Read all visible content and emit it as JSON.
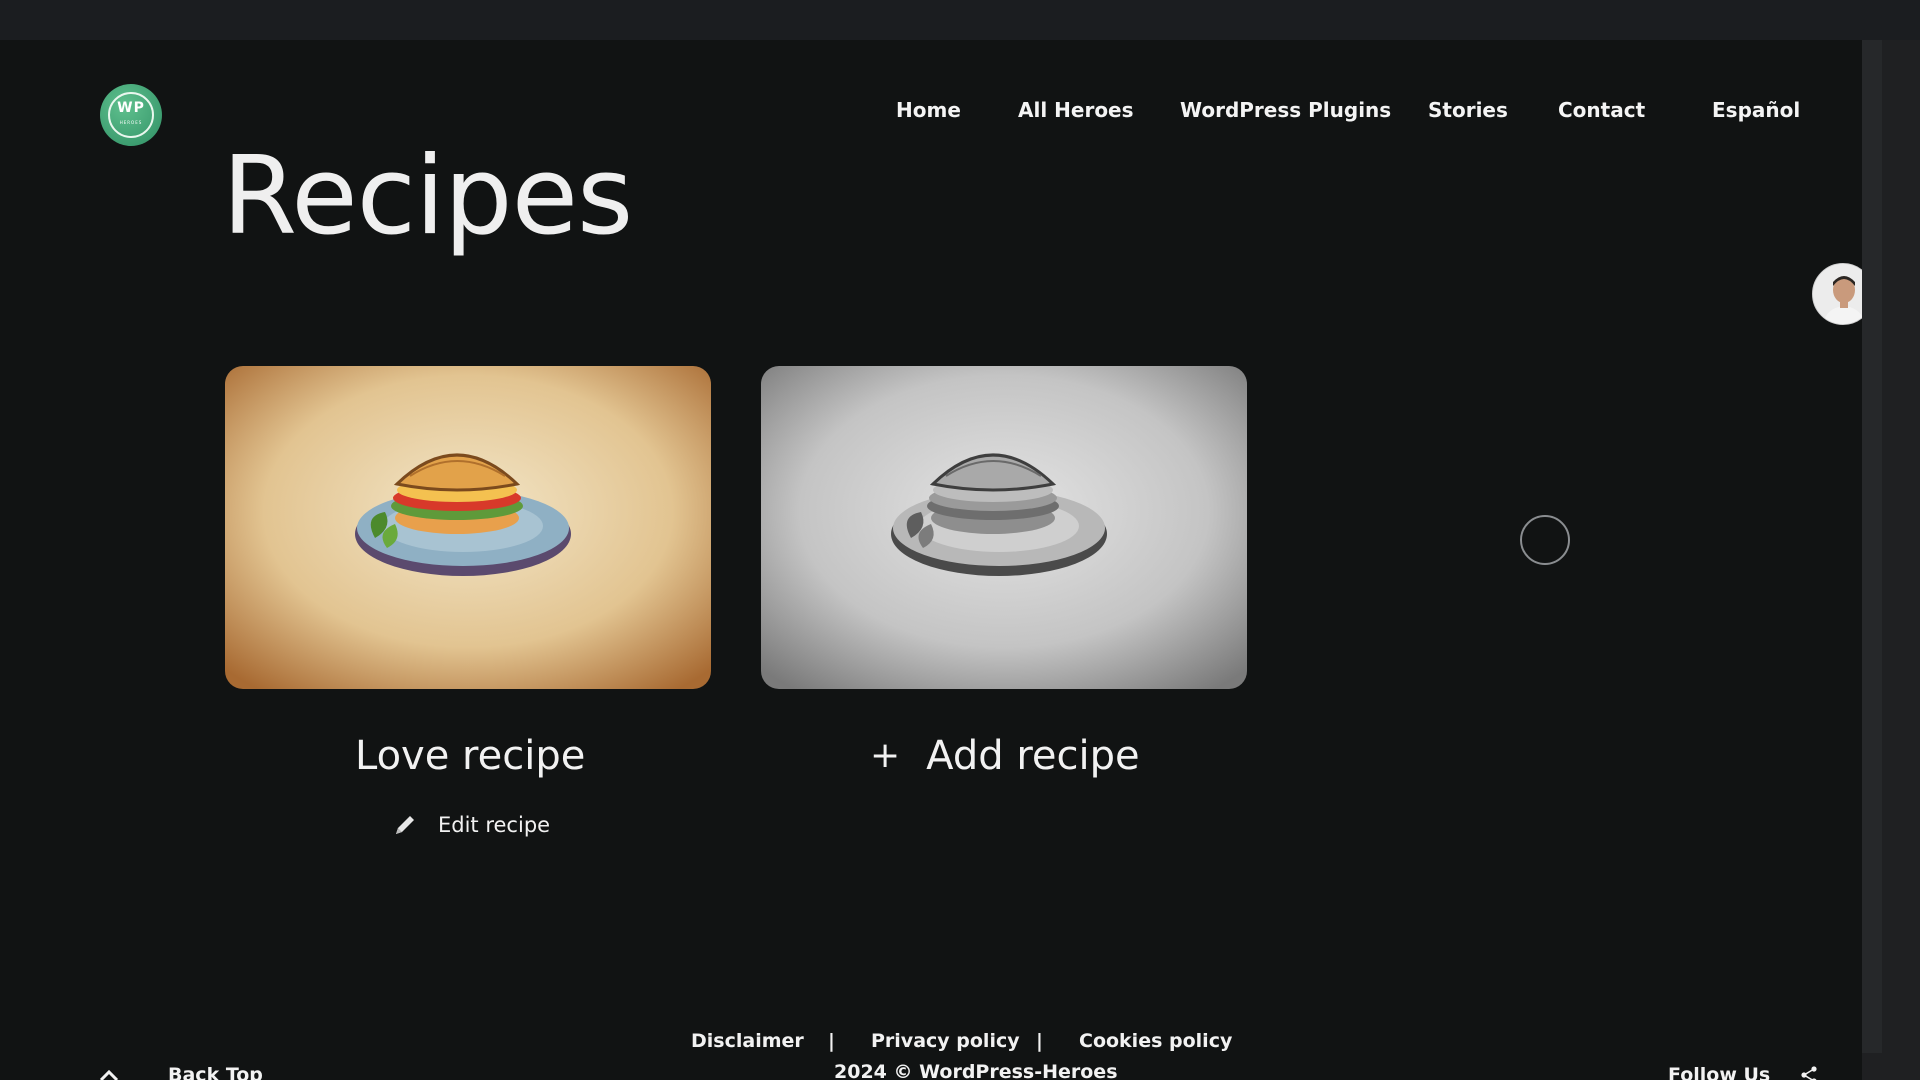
{
  "nav": {
    "items": [
      "Home",
      "All Heroes",
      "WordPress Plugins",
      "Stories",
      "Contact",
      "Español"
    ]
  },
  "logo": {
    "text": "WP",
    "subtext": "HEROES"
  },
  "page": {
    "title": "Recipes"
  },
  "cards": [
    {
      "title": "Love recipe",
      "action_label": "Edit recipe"
    },
    {
      "title": "Add recipe",
      "action_icon": "plus"
    }
  ],
  "footer": {
    "links": [
      "Disclaimer",
      "Privacy policy",
      "Cookies policy"
    ],
    "separator": "|",
    "copyright": "2024 © WordPress-Heroes",
    "back_top": "Back Top",
    "follow": "Follow Us"
  },
  "colors": {
    "background": "#111313",
    "accent": "#4fb583",
    "text": "#f2f2f2"
  },
  "icons": [
    "pencil-icon",
    "plus-icon",
    "chevron-up-icon",
    "share-icon",
    "arrow-left-icon"
  ]
}
